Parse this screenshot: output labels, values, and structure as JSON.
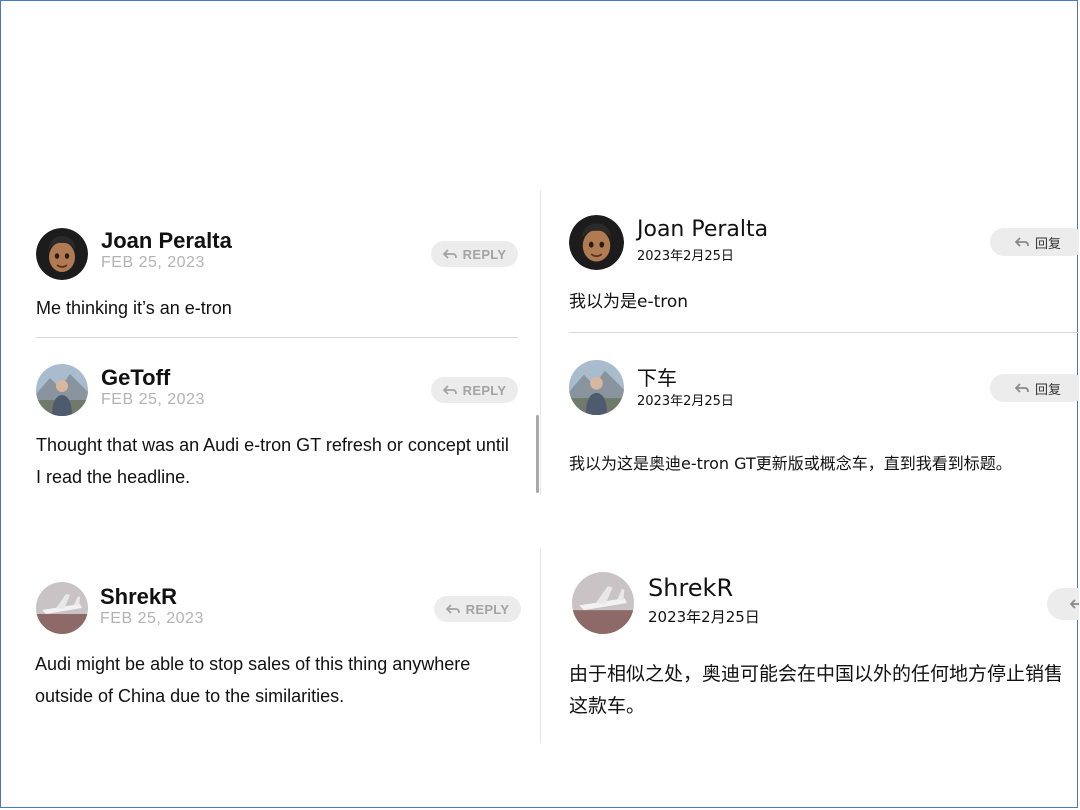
{
  "left_panel": {
    "comments": [
      {
        "author": "Joan Peralta",
        "date": "FEB 25, 2023",
        "reply_label": "REPLY",
        "text": "Me thinking it’s an e-tron",
        "avatar": "memoji-avatar"
      },
      {
        "author": "GeToff",
        "date": "FEB 25, 2023",
        "reply_label": "REPLY",
        "text": "Thought that was an Audi e-tron GT refresh or concept until I read the headline.",
        "avatar": "photo-avatar-person"
      },
      {
        "author": "ShrekR",
        "date": "FEB 25, 2023",
        "reply_label": "REPLY",
        "text": "Audi might be able to stop sales of this thing anywhere outside of China due to the similarities.",
        "avatar": "photo-avatar-airplane"
      }
    ]
  },
  "right_panel": {
    "comments": [
      {
        "author": "Joan Peralta",
        "date": "2023年2月25日",
        "reply_label": "回复",
        "text": "我以为是e-tron",
        "avatar": "memoji-avatar"
      },
      {
        "author": "下车",
        "date": "2023年2月25日",
        "reply_label": "回复",
        "text": "我以为这是奥迪e-tron GT更新版或概念车，直到我看到标题。",
        "avatar": "photo-avatar-person"
      },
      {
        "author": "ShrekR",
        "date": "2023年2月25日",
        "reply_label": "",
        "text": "由于相似之处，奥迪可能会在中国以外的任何地方停止销售这款车。",
        "avatar": "photo-avatar-airplane"
      }
    ]
  },
  "colors": {
    "frame_border": "#4a78c8",
    "date_gray": "#b3b3b3",
    "reply_bg": "#ececec",
    "divider": "#d9d9d9"
  }
}
